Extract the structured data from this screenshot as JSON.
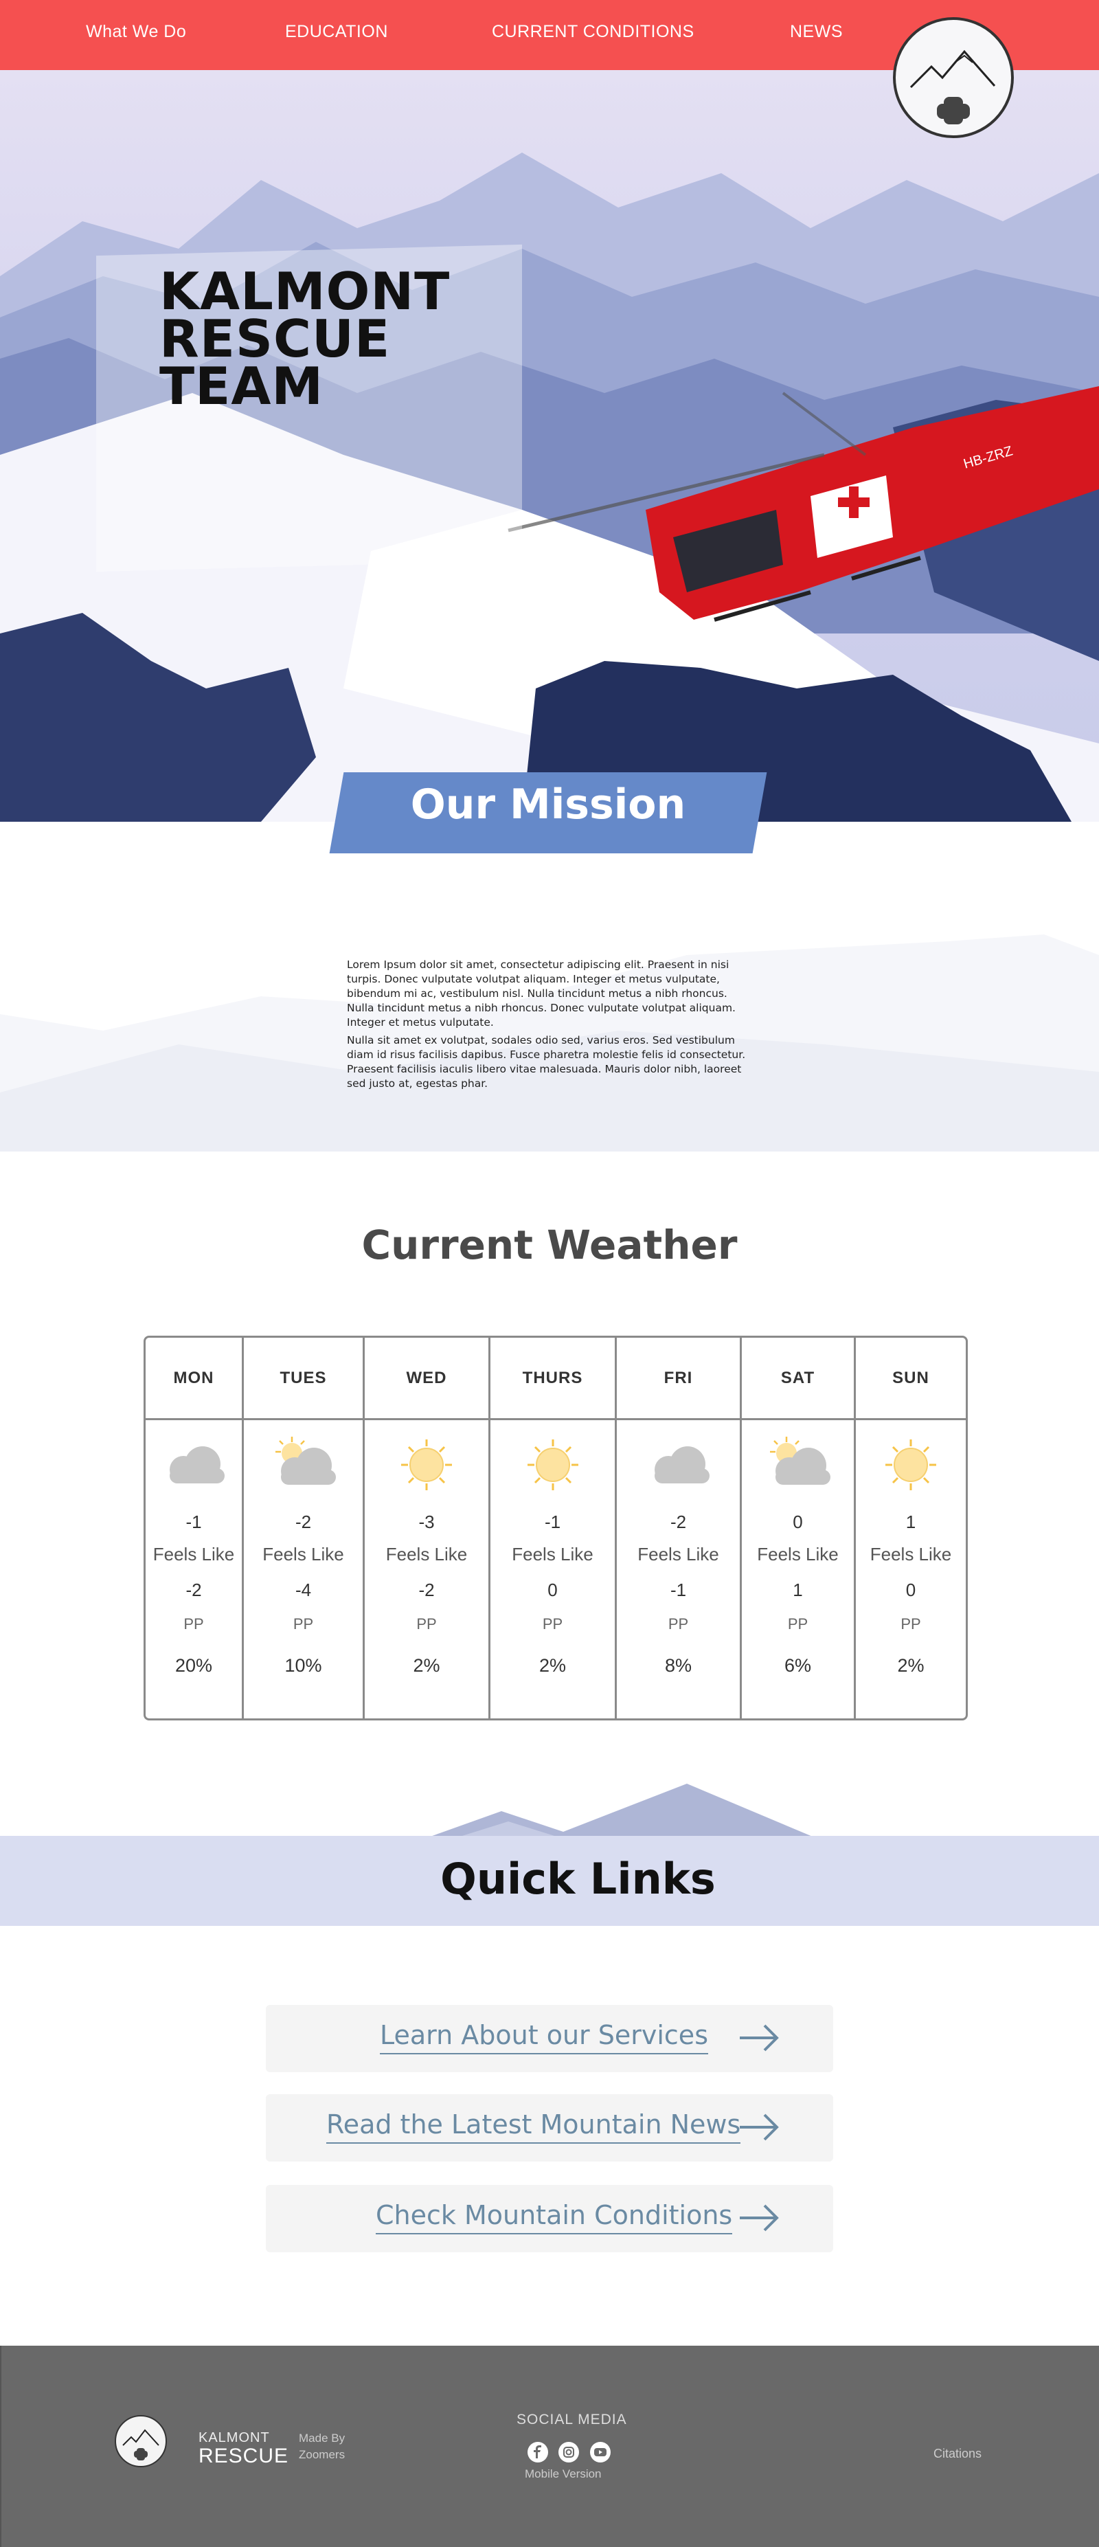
{
  "nav": {
    "links": [
      "What We Do",
      "EDUCATION",
      "CURRENT CONDITIONS",
      "NEWS"
    ]
  },
  "hero": {
    "title_lines": [
      "KALMONT",
      "RESCUE",
      "TEAM"
    ],
    "helicopter_registration": "HB-ZRZ"
  },
  "mission": {
    "title": "Our Mission",
    "paragraphs": [
      "Lorem Ipsum dolor sit amet, consectetur adipiscing elit. Praesent in nisi turpis. Donec vulputate volutpat aliquam. Integer et metus vulputate, bibendum mi ac, vestibulum nisl. Nulla tincidunt metus a nibh rhoncus. Nulla tincidunt metus a nibh rhoncus.  Donec vulputate volutpat aliquam. Integer et metus vulputate.",
      "Nulla sit amet ex volutpat, sodales odio sed, varius eros. Sed vestibulum diam id risus facilisis dapibus. Fusce pharetra molestie felis id consectetur. Praesent facilisis iaculis libero vitae malesuada. Mauris dolor nibh, laoreet sed justo at, egestas phar."
    ]
  },
  "weather": {
    "title": "Current Weather",
    "days": [
      {
        "day": "MON",
        "icon": "cloud-icon",
        "temp": "-1",
        "feels_label": "Feels Like",
        "feels": "-2",
        "pp_label": "PP",
        "pp": "20%"
      },
      {
        "day": "TUES",
        "icon": "sun-cloud-icon",
        "temp": "-2",
        "feels_label": "Feels Like",
        "feels": "-4",
        "pp_label": "PP",
        "pp": "10%"
      },
      {
        "day": "WED",
        "icon": "sun-icon",
        "temp": "-3",
        "feels_label": "Feels Like",
        "feels": "-2",
        "pp_label": "PP",
        "pp": "2%"
      },
      {
        "day": "THURS",
        "icon": "sun-icon",
        "temp": "-1",
        "feels_label": "Feels Like",
        "feels": "0",
        "pp_label": "PP",
        "pp": "2%"
      },
      {
        "day": "FRI",
        "icon": "cloud-icon",
        "temp": "-2",
        "feels_label": "Feels Like",
        "feels": "-1",
        "pp_label": "PP",
        "pp": "8%"
      },
      {
        "day": "SAT",
        "icon": "sun-cloud-icon",
        "temp": "0",
        "feels_label": "Feels Like",
        "feels": "1",
        "pp_label": "PP",
        "pp": "6%"
      },
      {
        "day": "SUN",
        "icon": "sun-icon",
        "temp": "1",
        "feels_label": "Feels Like",
        "feels": "0",
        "pp_label": "PP",
        "pp": "2%"
      }
    ]
  },
  "quick_links": {
    "title": "Quick Links",
    "items": [
      {
        "label": "Learn About our Services"
      },
      {
        "label": "Read the Latest Mountain News"
      },
      {
        "label": "Check Mountain Conditions"
      }
    ]
  },
  "footer": {
    "brand_top": "KALMONT",
    "brand_bottom": "RESCUE",
    "made_by": "Made By Zoomers",
    "social_title": "SOCIAL MEDIA",
    "social_icons": [
      "facebook-icon",
      "instagram-icon",
      "youtube-icon"
    ],
    "mobile_link": "Mobile Version",
    "citations_link": "Citations"
  },
  "colors": {
    "nav_red": "#f55050",
    "mission_blue": "#6589c9",
    "link_blue": "#6a8aa3",
    "quicklinks_band": "#d9ddf1",
    "footer_gray": "#696969",
    "sun_yellow": "#fde3a0"
  }
}
